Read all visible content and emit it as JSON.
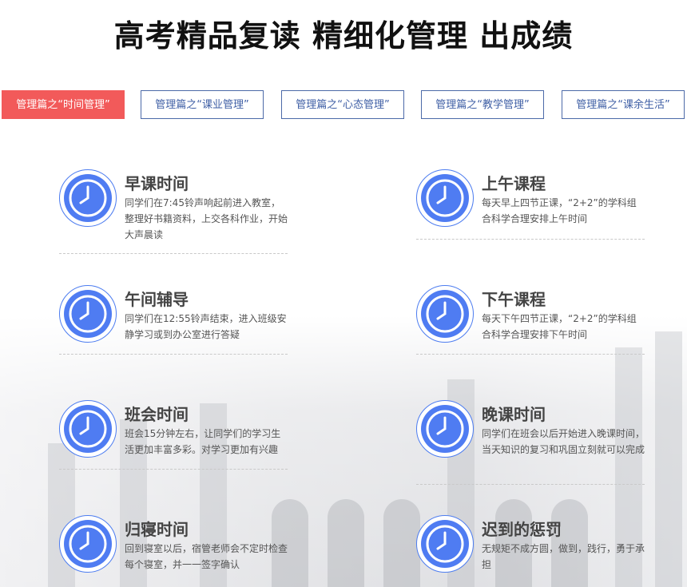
{
  "title": "高考精品复读 精细化管理 出成绩",
  "tabs": [
    {
      "label": "管理篇之“时间管理”",
      "active": true
    },
    {
      "label": "管理篇之“课业管理”",
      "active": false
    },
    {
      "label": "管理篇之“心态管理”",
      "active": false
    },
    {
      "label": "管理篇之“教学管理”",
      "active": false
    },
    {
      "label": "管理篇之“课余生活”",
      "active": false
    }
  ],
  "items": [
    {
      "title": "早课时间",
      "desc": "同学们在7:45铃声响起前进入教室，整理好书籍资料，上交各科作业，开始大声晨读"
    },
    {
      "title": "上午课程",
      "desc": "每天早上四节正课，“2+2”的学科组合科学合理安排上午时间"
    },
    {
      "title": "午间辅导",
      "desc": "同学们在12:55铃声结束，进入班级安静学习或到办公室进行答疑"
    },
    {
      "title": "下午课程",
      "desc": "每天下午四节正课，“2+2”的学科组合科学合理安排下午时间"
    },
    {
      "title": "班会时间",
      "desc": "班会15分钟左右，让同学们的学习生活更加丰富多彩。对学习更加有兴趣"
    },
    {
      "title": "晚课时间",
      "desc": "同学们在班会以后开始进入晚课时间，当天知识的复习和巩固立刻就可以完成"
    },
    {
      "title": "归寝时间",
      "desc": "回到寝室以后，宿管老师会不定时检查每个寝室，并一一签字确认"
    },
    {
      "title": "迟到的惩罚",
      "desc": "无规矩不成方圆，做到，践行，勇于承担"
    }
  ],
  "colors": {
    "accent": "#f25a5a",
    "tab_border": "#4c6aa8",
    "clock_blue": "#4c7cf0"
  },
  "icons": {
    "item_icon": "clock-icon"
  }
}
